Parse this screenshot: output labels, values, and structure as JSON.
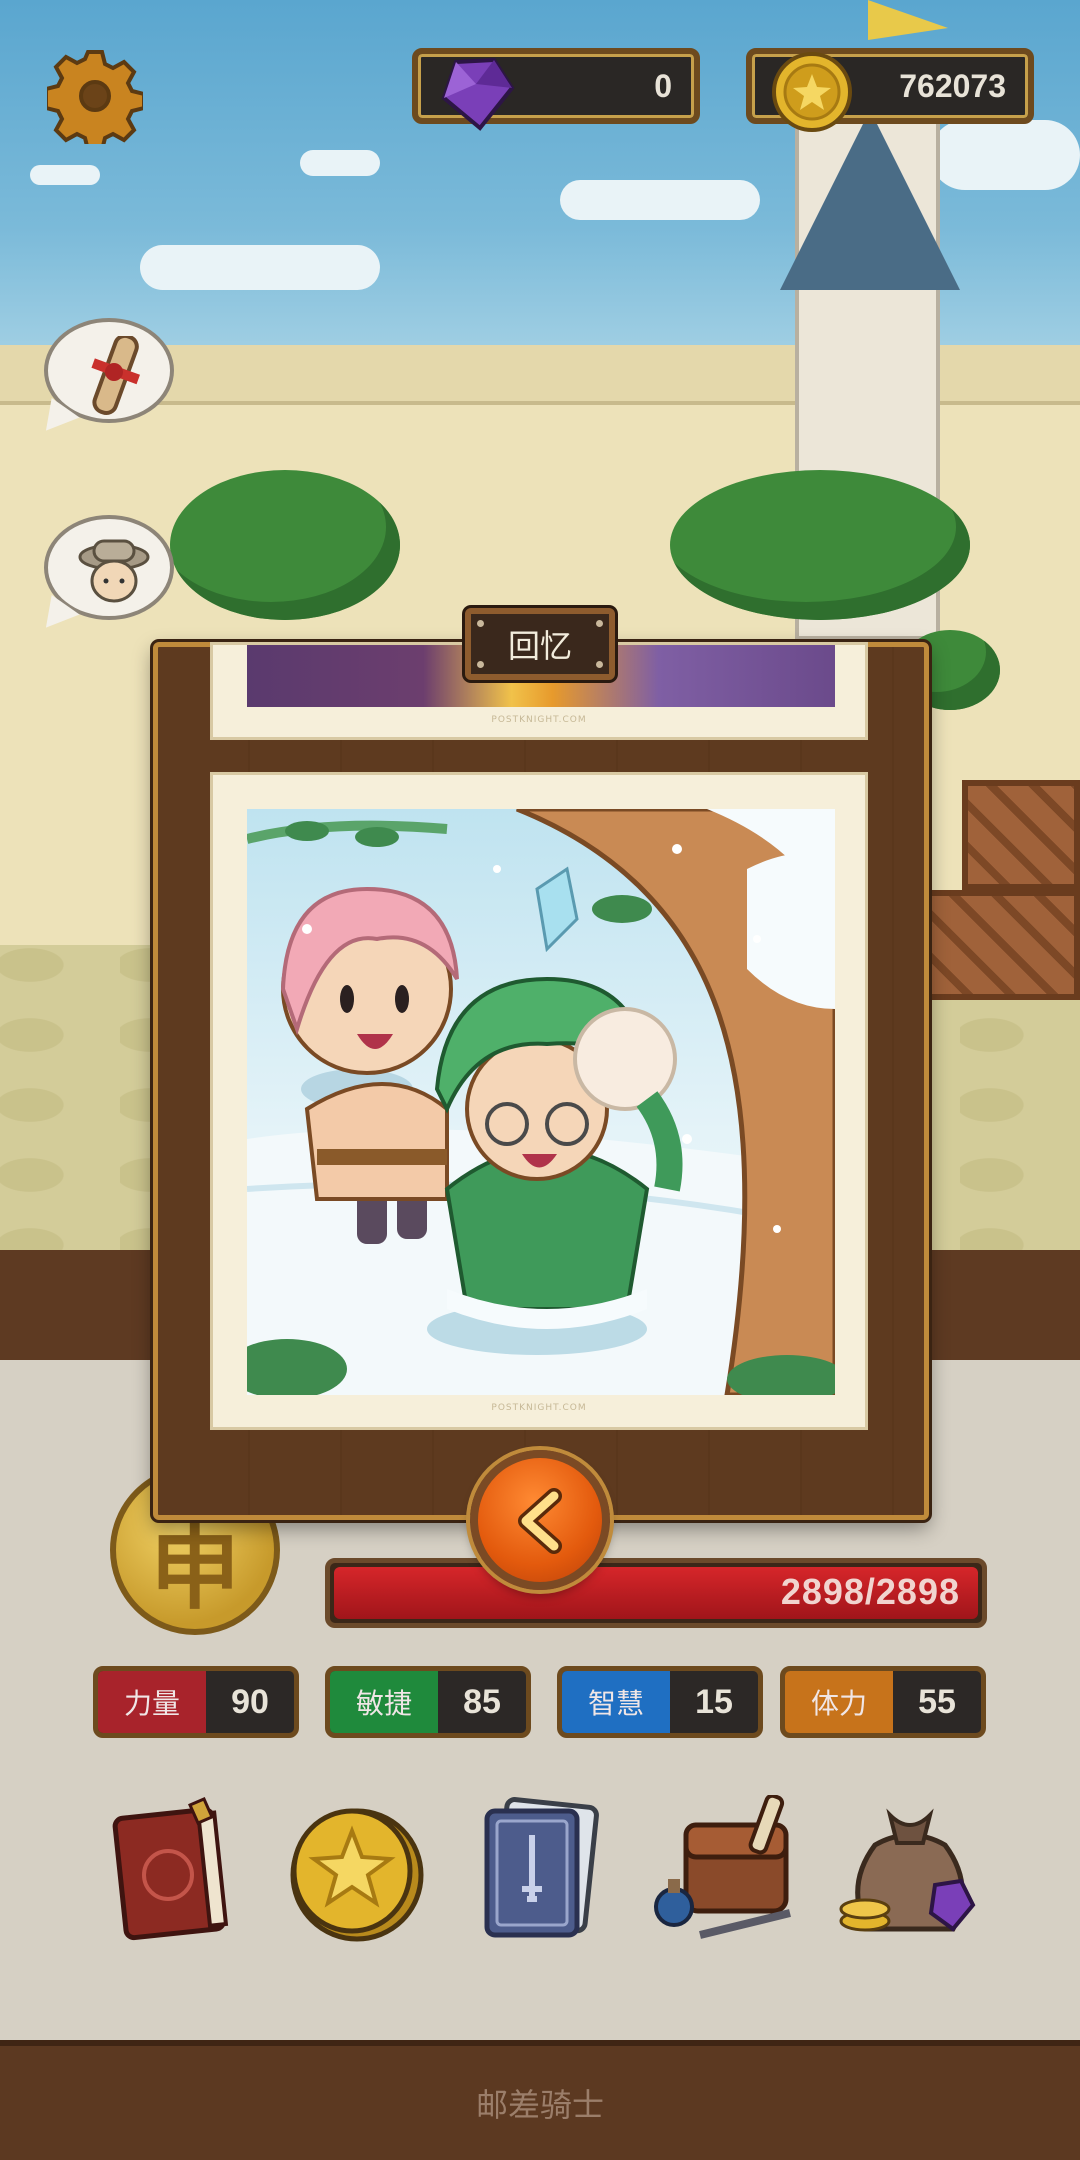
{
  "currencies": {
    "gems": "0",
    "coins": "762073"
  },
  "modal": {
    "title": "回忆",
    "watermark": "POSTKNIGHT.COM"
  },
  "character": {
    "hp_text": "2898/2898",
    "hp_fraction": 1.0,
    "medal_glyph": "申"
  },
  "stats": [
    {
      "label": "力量",
      "value": "90",
      "color": "#a8232b"
    },
    {
      "label": "敏捷",
      "value": "85",
      "color": "#1f8a3c"
    },
    {
      "label": "智慧",
      "value": "15",
      "color": "#1f6fc2"
    },
    {
      "label": "体力",
      "value": "55",
      "color": "#c7731b"
    }
  ],
  "menu": [
    {
      "icon": "journal-book-icon"
    },
    {
      "icon": "star-coin-icon"
    },
    {
      "icon": "cards-deck-icon"
    },
    {
      "icon": "equipment-bag-icon"
    },
    {
      "icon": "loot-sack-icon"
    }
  ],
  "footer": {
    "title": "邮差骑士"
  }
}
